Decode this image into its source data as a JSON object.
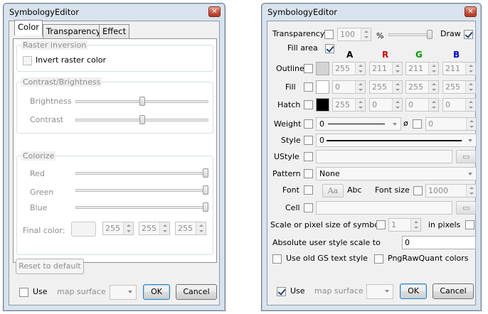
{
  "left": {
    "title": "SymbologyEditor",
    "close_glyph": "✕",
    "tabs": [
      {
        "label": "Color",
        "active": true
      },
      {
        "label": "Transparency",
        "active": false
      },
      {
        "label": "Effect",
        "active": false
      }
    ],
    "raster_inversion": {
      "group_label": "Raster inversion",
      "invert_label": "Invert raster color",
      "invert_checked": false
    },
    "contrast_brightness": {
      "group_label": "Contrast/Brightness",
      "brightness_label": "Brightness",
      "brightness_value": 0.5,
      "contrast_label": "Contrast",
      "contrast_value": 0.5
    },
    "colorize": {
      "group_label": "Colorize",
      "red_label": "Red",
      "red_value": 1.0,
      "green_label": "Green",
      "green_value": 1.0,
      "blue_label": "Blue",
      "blue_value": 1.0,
      "final_color_label": "Final color:",
      "final_r": "255",
      "final_g": "255",
      "final_b": "255"
    },
    "reset_label": "Reset to default",
    "use_label": "Use",
    "use_checked": false,
    "map_surface_label": "map surface",
    "ok_label": "OK",
    "cancel_label": "Cancel"
  },
  "right": {
    "title": "SymbologyEditor",
    "close_glyph": "✕",
    "transparency_label": "Transparency",
    "transparency_checked": false,
    "transparency_value": "100",
    "percent_label": "%",
    "transparency_slider": 1.0,
    "draw_label": "Draw",
    "draw_checked": true,
    "fill_area_label": "Fill area",
    "fill_area_checked": true,
    "channel_headers": [
      {
        "label": "A",
        "color": "#000000"
      },
      {
        "label": "R",
        "color": "#cc0000"
      },
      {
        "label": "G",
        "color": "#009900"
      },
      {
        "label": "B",
        "color": "#0000cc"
      }
    ],
    "color_rows": [
      {
        "label": "Outline",
        "checked": false,
        "swatch": "#d3d3d3",
        "a": "255",
        "r": "211",
        "g": "211",
        "b": "211"
      },
      {
        "label": "Fill",
        "checked": false,
        "swatch": "#ffffff",
        "a": "0",
        "r": "255",
        "g": "255",
        "b": "255"
      },
      {
        "label": "Hatch",
        "checked": false,
        "swatch": "#000000",
        "a": "255",
        "r": "0",
        "g": "0",
        "b": "0"
      }
    ],
    "weight_label": "Weight",
    "weight_value": "0",
    "diameter_symbol": "ø",
    "diameter_value": "0",
    "style_label": "Style",
    "style_value": "0",
    "ustyle_label": "UStyle",
    "pattern_label": "Pattern",
    "pattern_value": "None",
    "font_label": "Font",
    "font_button_glyph": "Aa",
    "font_sample": "Abc",
    "font_size_label": "Font size",
    "font_size_value": "1000",
    "cell_label": "Cell",
    "scale_label": "Scale or pixel size of symbols",
    "scale_value": "1",
    "in_pixels_label": "in pixels",
    "abs_scale_label": "Absolute user style scale to",
    "abs_scale_value": "0",
    "old_gs_label": "Use old GS text style",
    "png_raw_label": "PngRawQuant colors",
    "use_label": "Use",
    "use_checked": true,
    "map_surface_label": "map surface",
    "ok_label": "OK",
    "cancel_label": "Cancel",
    "folder_glyph": "▭"
  }
}
